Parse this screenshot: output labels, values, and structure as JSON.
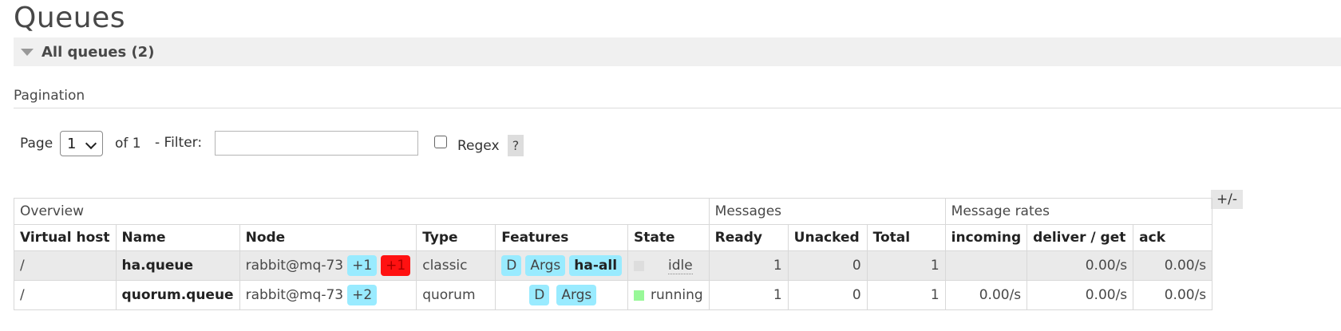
{
  "page": {
    "title": "Queues"
  },
  "section": {
    "label": "All queues (2)"
  },
  "pagination": {
    "title": "Pagination",
    "page_label": "Page",
    "page_value": "1",
    "of_label": "of 1",
    "filter_label": "- Filter:",
    "filter_value": "",
    "regex_label": "Regex",
    "help_label": "?"
  },
  "table": {
    "toggle_label": "+/-",
    "groups": {
      "overview": "Overview",
      "messages": "Messages",
      "rates": "Message rates"
    },
    "columns": {
      "vhost": "Virtual host",
      "name": "Name",
      "node": "Node",
      "type": "Type",
      "features": "Features",
      "state": "State",
      "ready": "Ready",
      "unacked": "Unacked",
      "total": "Total",
      "incoming": "incoming",
      "deliver_get": "deliver / get",
      "ack": "ack"
    },
    "rows": [
      {
        "vhost": "/",
        "name": "ha.queue",
        "node": "rabbit@mq-73",
        "node_badge1": "+1",
        "node_badge2": "+1",
        "type": "classic",
        "feat1": "D",
        "feat2": "Args",
        "feat3": "ha-all",
        "state": "idle",
        "ready": "1",
        "unacked": "0",
        "total": "1",
        "incoming": "",
        "deliver_get": "0.00/s",
        "ack": "0.00/s"
      },
      {
        "vhost": "/",
        "name": "quorum.queue",
        "node": "rabbit@mq-73",
        "node_badge1": "+2",
        "type": "quorum",
        "feat1": "D",
        "feat2": "Args",
        "state": "running",
        "ready": "1",
        "unacked": "0",
        "total": "1",
        "incoming": "0.00/s",
        "deliver_get": "0.00/s",
        "ack": "0.00/s"
      }
    ]
  },
  "colors": {
    "badge_blue": "#99ebff",
    "badge_red": "#ff1111",
    "state_idle": "#dddddd",
    "state_running": "#98f898",
    "header_bg": "#f0f0f0"
  }
}
